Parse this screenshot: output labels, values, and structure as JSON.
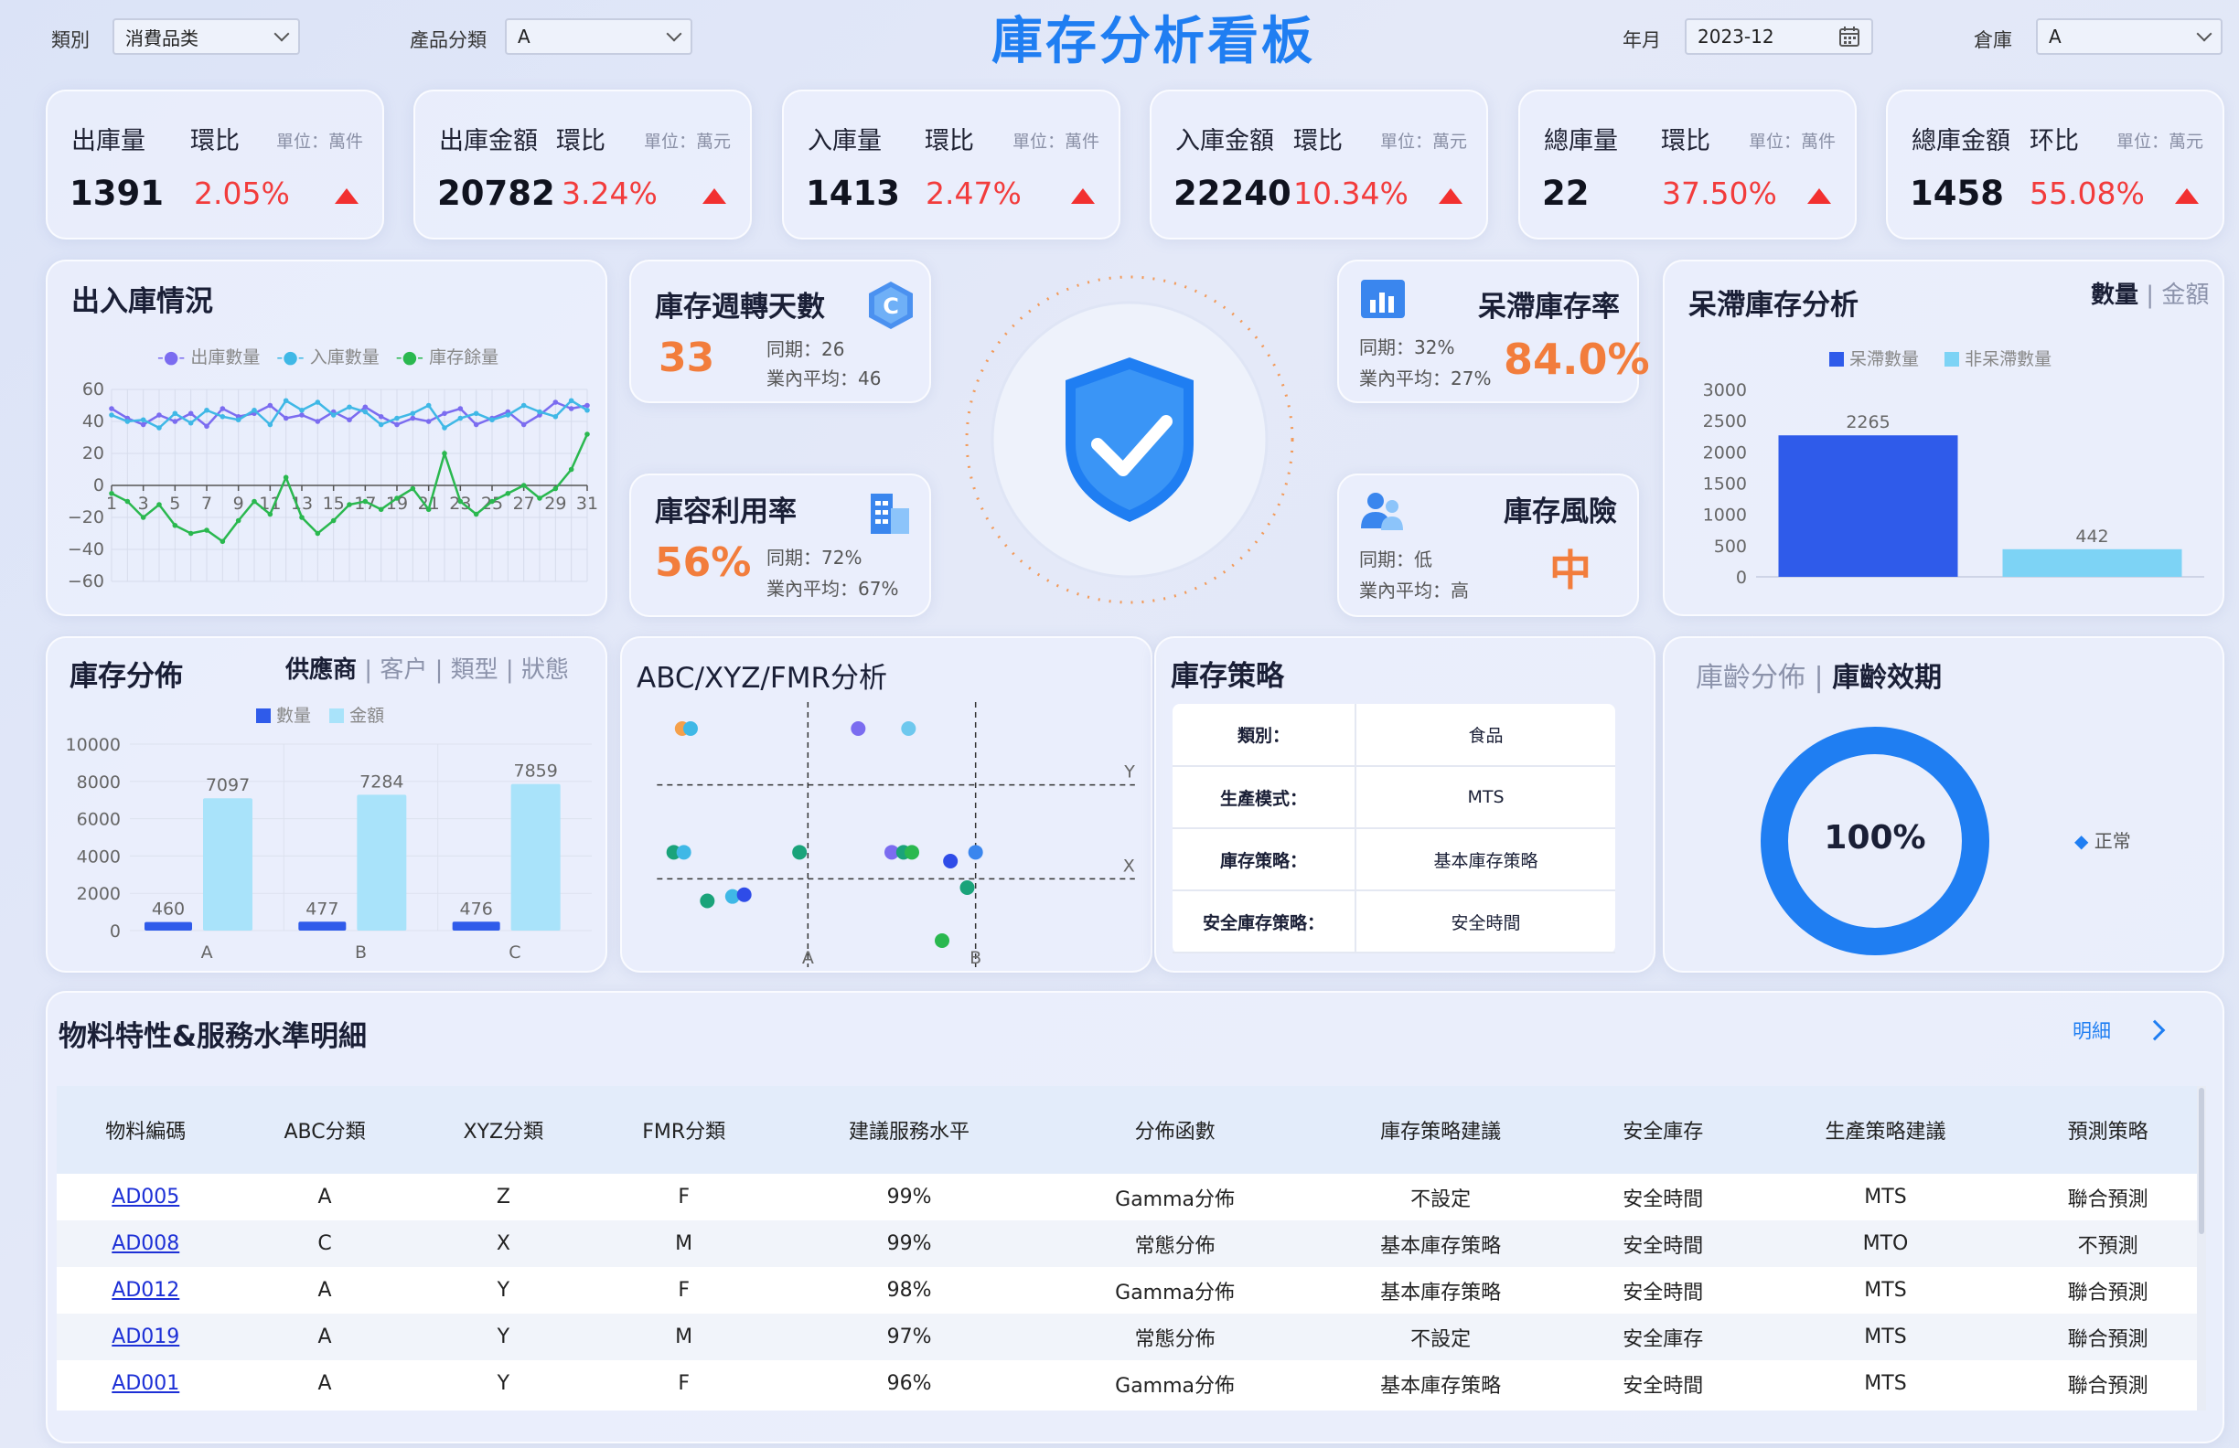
{
  "header": {
    "title": "庫存分析看板",
    "filters": {
      "category_label": "類別",
      "category_value": "消費品类",
      "product_label": "產品分類",
      "product_value": "A",
      "month_label": "年月",
      "month_value": "2023-12",
      "warehouse_label": "倉庫",
      "warehouse_value": "A"
    }
  },
  "kpis": [
    {
      "name": "出庫量",
      "ratio_label": "環比",
      "unit": "單位：萬件",
      "value": "1391",
      "pct": "2.05%"
    },
    {
      "name": "出庫金額",
      "ratio_label": "環比",
      "unit": "單位：萬元",
      "value": "20782",
      "pct": "3.24%"
    },
    {
      "name": "入庫量",
      "ratio_label": "環比",
      "unit": "單位：萬件",
      "value": "1413",
      "pct": "2.47%"
    },
    {
      "name": "入庫金額",
      "ratio_label": "環比",
      "unit": "單位：萬元",
      "value": "22240",
      "pct": "10.34%"
    },
    {
      "name": "總庫量",
      "ratio_label": "環比",
      "unit": "單位：萬件",
      "value": "22",
      "pct": "37.50%"
    },
    {
      "name": "總庫金額",
      "ratio_label": "环比",
      "unit": "單位：萬元",
      "value": "1458",
      "pct": "55.08%"
    }
  ],
  "inout": {
    "title": "出入庫情況",
    "legend": [
      "出庫數量",
      "入庫數量",
      "庫存餘量"
    ]
  },
  "turnover": {
    "title": "庫存週轉天數",
    "value": "33",
    "prev": "同期：26",
    "avg": "業內平均：46"
  },
  "utilization": {
    "title": "庫容利用率",
    "value": "56%",
    "prev": "同期：72%",
    "avg": "業內平均：67%"
  },
  "stagnant_rate": {
    "title": "呆滯庫存率",
    "value": "84.0%",
    "prev": "同期：32%",
    "avg": "業內平均：27%"
  },
  "risk": {
    "title": "庫存風險",
    "value": "中",
    "prev": "同期：低",
    "avg": "業內平均：高"
  },
  "stagnant": {
    "title": "呆滯庫存分析",
    "tab_on": "數量",
    "tab_off": "金額",
    "legend": [
      "呆滯數量",
      "非呆滯數量"
    ]
  },
  "distribution": {
    "title": "庫存分佈",
    "tabs": [
      "供應商",
      "客户",
      "類型",
      "狀態"
    ],
    "legend": [
      "數量",
      "金額"
    ]
  },
  "abc": {
    "title": "ABC/XYZ/FMR分析"
  },
  "strategy": {
    "title": "庫存策略",
    "rows": [
      {
        "k": "類別：",
        "v": "食品"
      },
      {
        "k": "生產模式：",
        "v": "MTS"
      },
      {
        "k": "庫存策略：",
        "v": "基本庫存策略"
      },
      {
        "k": "安全庫存策略：",
        "v": "安全時間"
      }
    ]
  },
  "age": {
    "tab_off": "庫齡分佈",
    "tab_on": "庫齡效期",
    "center": "100%",
    "legend": "正常"
  },
  "detail": {
    "title": "物料特性&服務水準明細",
    "link": "明細",
    "columns": [
      "物料編碼",
      "ABC分類",
      "XYZ分類",
      "FMR分類",
      "建議服務水平",
      "分佈函數",
      "庫存策略建議",
      "安全庫存",
      "生產策略建議",
      "預測策略"
    ],
    "rows": [
      [
        "AD005",
        "A",
        "Z",
        "F",
        "99%",
        "Gamma分佈",
        "不設定",
        "安全時間",
        "MTS",
        "聯合預測"
      ],
      [
        "AD008",
        "C",
        "X",
        "M",
        "99%",
        "常態分佈",
        "基本庫存策略",
        "安全時間",
        "MTO",
        "不預測"
      ],
      [
        "AD012",
        "A",
        "Y",
        "F",
        "98%",
        "Gamma分佈",
        "基本庫存策略",
        "安全時間",
        "MTS",
        "聯合預測"
      ],
      [
        "AD019",
        "A",
        "Y",
        "M",
        "97%",
        "常態分佈",
        "不設定",
        "安全庫存",
        "MTS",
        "聯合預測"
      ],
      [
        "AD001",
        "A",
        "Y",
        "F",
        "96%",
        "Gamma分佈",
        "基本庫存策略",
        "安全時間",
        "MTS",
        "聯合預測"
      ]
    ]
  },
  "colors": {
    "accent": "#1f7ef2",
    "up": "#f23c3c",
    "orange": "#f27d3c",
    "bar_dark": "#2f5bea",
    "bar_light": "#7dd3f5"
  },
  "chart_data": [
    {
      "type": "line",
      "title": "出入庫情況",
      "x": [
        1,
        2,
        3,
        4,
        5,
        6,
        7,
        8,
        9,
        10,
        11,
        12,
        13,
        14,
        15,
        16,
        17,
        18,
        19,
        20,
        21,
        22,
        23,
        24,
        25,
        26,
        27,
        28,
        29,
        30,
        31
      ],
      "x_ticks": [
        "1",
        "3",
        "5",
        "7",
        "9",
        "11",
        "13",
        "15",
        "17",
        "19",
        "21",
        "23",
        "25",
        "27",
        "29",
        "31"
      ],
      "ylim": [
        -60,
        60
      ],
      "y_ticks": [
        "60",
        "40",
        "20",
        "0",
        "−20",
        "−40",
        "−60"
      ],
      "series": [
        {
          "name": "出庫數量",
          "color": "#7b6cf0",
          "values": [
            48,
            42,
            38,
            44,
            40,
            45,
            37,
            48,
            43,
            45,
            50,
            42,
            44,
            40,
            46,
            41,
            49,
            43,
            38,
            42,
            40,
            45,
            48,
            38,
            42,
            46,
            38,
            44,
            52,
            48,
            50
          ]
        },
        {
          "name": "入庫數量",
          "color": "#3fb8e6",
          "values": [
            44,
            40,
            41,
            36,
            45,
            39,
            47,
            43,
            41,
            47,
            38,
            53,
            47,
            52,
            44,
            49,
            46,
            38,
            42,
            45,
            50,
            36,
            42,
            45,
            41,
            44,
            50,
            46,
            43,
            53,
            47
          ]
        },
        {
          "name": "庫存餘量",
          "color": "#2ab84f",
          "values": [
            -5,
            -10,
            -20,
            -12,
            -25,
            -30,
            -28,
            -35,
            -22,
            -10,
            -18,
            5,
            -20,
            -30,
            -22,
            -12,
            -10,
            -15,
            -8,
            -2,
            -15,
            20,
            -10,
            -18,
            -10,
            -5,
            0,
            -8,
            -2,
            10,
            32
          ]
        }
      ]
    },
    {
      "type": "bar",
      "title": "呆滯庫存分析",
      "categories": [
        "呆滯數量",
        "非呆滯數量"
      ],
      "values": [
        2265,
        442
      ],
      "ylim": [
        0,
        3000
      ],
      "y_ticks": [
        "3000",
        "2500",
        "2000",
        "1500",
        "1000",
        "500",
        "0"
      ]
    },
    {
      "type": "bar",
      "title": "庫存分佈",
      "categories": [
        "A",
        "B",
        "C"
      ],
      "series": [
        {
          "name": "數量",
          "values": [
            460,
            477,
            476
          ]
        },
        {
          "name": "金額",
          "values": [
            7097,
            7284,
            7859
          ]
        }
      ],
      "ylim": [
        0,
        10000
      ],
      "y_ticks": [
        "10000",
        "8000",
        "6000",
        "4000",
        "2000",
        "0"
      ]
    },
    {
      "type": "scatter",
      "title": "ABC/XYZ/FMR分析",
      "x_labels": [
        "A",
        "B"
      ],
      "y_labels": [
        "Y",
        "X"
      ],
      "xlim": [
        0,
        3
      ],
      "ylim": [
        0,
        3
      ],
      "points": [
        {
          "x": 0.25,
          "y": 2.7,
          "color": "#f5a04a"
        },
        {
          "x": 0.3,
          "y": 2.7,
          "color": "#3fb8e6"
        },
        {
          "x": 1.3,
          "y": 2.7,
          "color": "#7b6cf0"
        },
        {
          "x": 1.6,
          "y": 2.7,
          "color": "#6ec8ee"
        },
        {
          "x": 0.2,
          "y": 1.3,
          "color": "#1aa37a"
        },
        {
          "x": 0.26,
          "y": 1.3,
          "color": "#3fb8e6"
        },
        {
          "x": 0.95,
          "y": 1.3,
          "color": "#1aa37a"
        },
        {
          "x": 1.5,
          "y": 1.3,
          "color": "#7b6cf0"
        },
        {
          "x": 1.57,
          "y": 1.3,
          "color": "#1aa37a"
        },
        {
          "x": 1.62,
          "y": 1.3,
          "color": "#2ab84f"
        },
        {
          "x": 1.85,
          "y": 1.2,
          "color": "#2f4ce8"
        },
        {
          "x": 2.0,
          "y": 1.3,
          "color": "#3a86ee"
        },
        {
          "x": 1.95,
          "y": 0.9,
          "color": "#1aa37a"
        },
        {
          "x": 0.4,
          "y": 0.75,
          "color": "#1aa37a"
        },
        {
          "x": 0.55,
          "y": 0.8,
          "color": "#3fb8e6"
        },
        {
          "x": 0.62,
          "y": 0.82,
          "color": "#2f4ce8"
        },
        {
          "x": 1.8,
          "y": 0.3,
          "color": "#2ab84f"
        }
      ]
    },
    {
      "type": "pie",
      "title": "庫齡效期",
      "categories": [
        "正常"
      ],
      "values": [
        100
      ]
    }
  ]
}
